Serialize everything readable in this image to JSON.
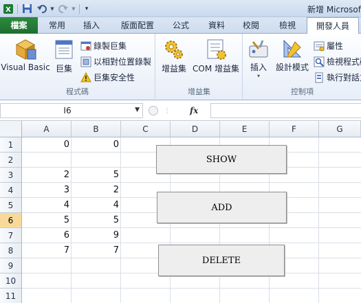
{
  "window": {
    "title": "新增 Microsoft"
  },
  "ribbon": {
    "tabs": [
      {
        "label": "檔案"
      },
      {
        "label": "常用"
      },
      {
        "label": "插入"
      },
      {
        "label": "版面配置"
      },
      {
        "label": "公式"
      },
      {
        "label": "資料"
      },
      {
        "label": "校閱"
      },
      {
        "label": "檢視"
      },
      {
        "label": "開發人員"
      }
    ],
    "code_group": {
      "label": "程式碼",
      "visual_basic": "Visual Basic",
      "macros": "巨集",
      "record_macro": "錄製巨集",
      "relative_ref": "以相對位置錄製",
      "macro_security": "巨集安全性"
    },
    "addins_group": {
      "label": "增益集",
      "addins": "增益集",
      "com_addins": "COM 增益集"
    },
    "controls_group": {
      "label": "控制項",
      "insert": "插入",
      "design_mode": "設計模式",
      "properties": "屬性",
      "view_code": "檢視程式碼",
      "run_dialog": "執行對話方塊"
    }
  },
  "formula_bar": {
    "name_box": "I6",
    "fx": "fx",
    "formula": ""
  },
  "sheet": {
    "columns": [
      "A",
      "B",
      "C",
      "D",
      "E",
      "F",
      "G"
    ],
    "rows": [
      "1",
      "2",
      "3",
      "4",
      "5",
      "6",
      "7",
      "8",
      "9",
      "10",
      "11"
    ],
    "selected_row": "6",
    "cells": {
      "A1": "0",
      "B1": "0",
      "A3": "2",
      "B3": "5",
      "A4": "3",
      "B4": "2",
      "A5": "4",
      "B5": "4",
      "A6": "5",
      "B6": "5",
      "A7": "6",
      "B7": "9",
      "A8": "7",
      "B8": "7"
    }
  },
  "form_buttons": {
    "show": "SHOW",
    "add": "ADD",
    "delete": "DELETE"
  },
  "colors": {
    "file_tab": "#2d8b3f",
    "selected_row_header": "#f9d99a",
    "ribbon_bg": "#e7eef8"
  }
}
